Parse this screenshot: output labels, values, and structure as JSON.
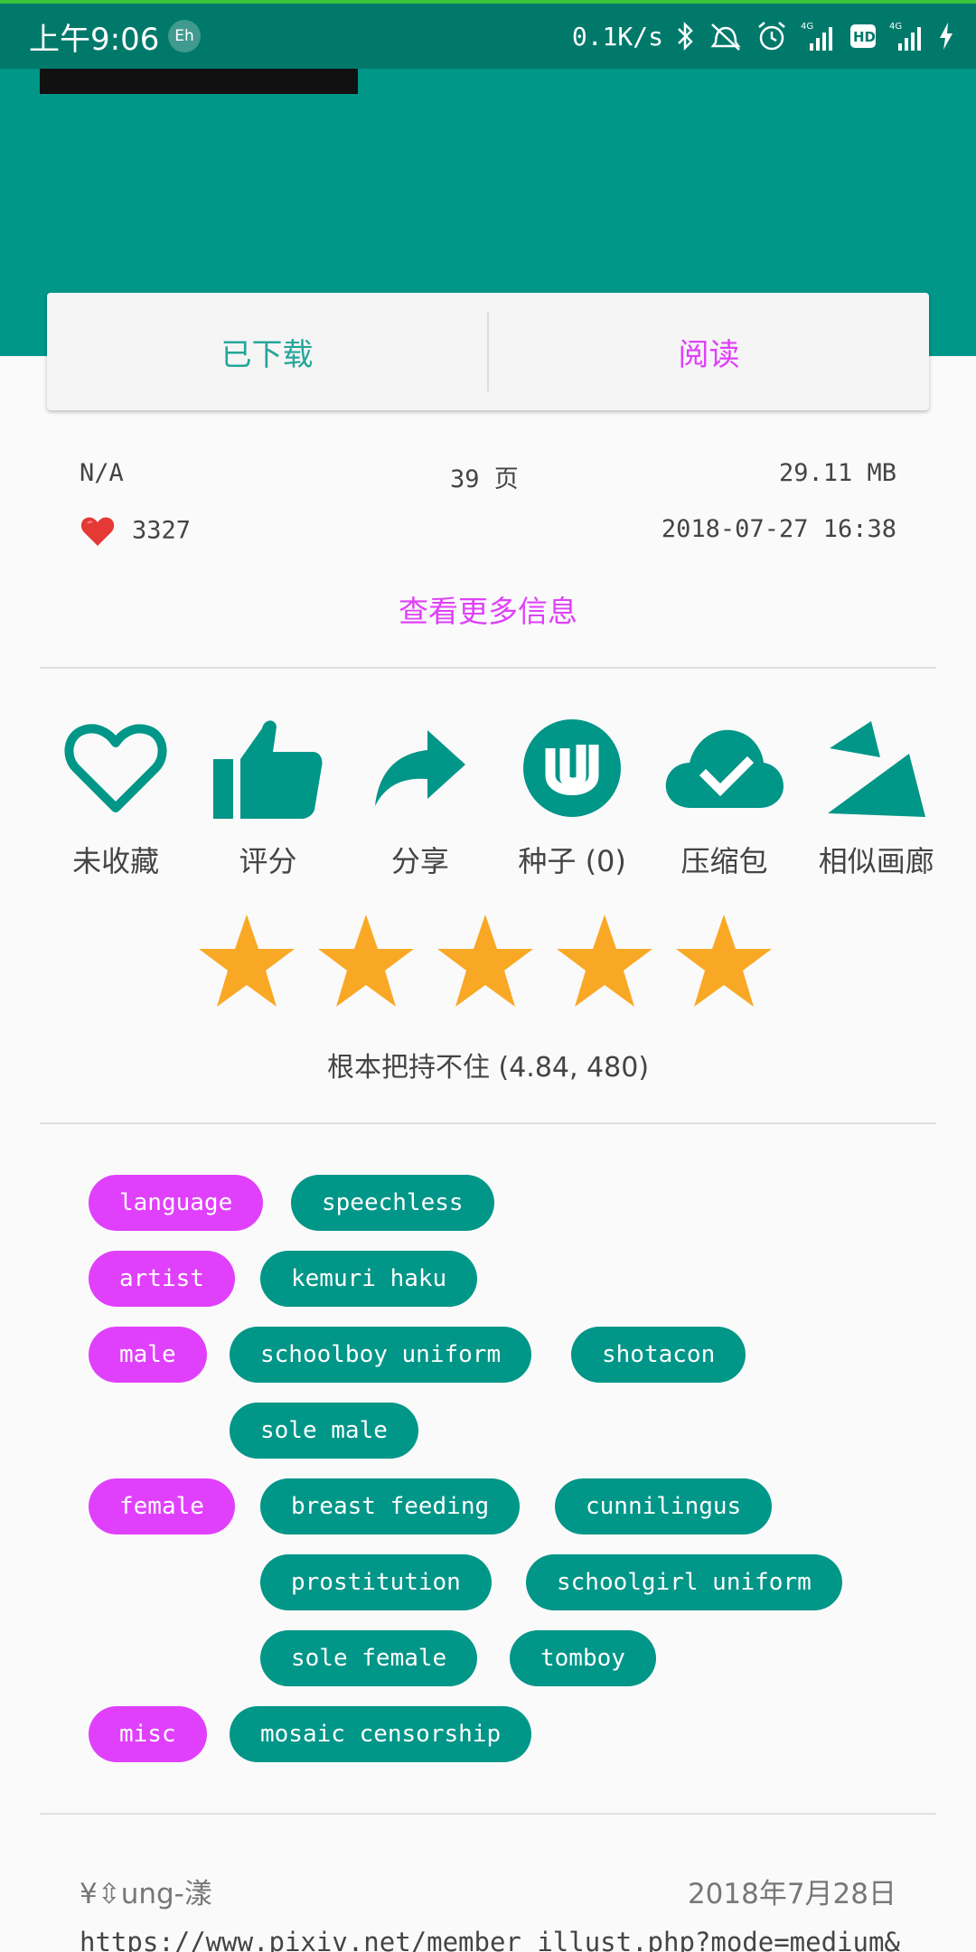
{
  "status_bar": {
    "time": "上午9:06",
    "eh_badge": "Eh",
    "net_speed": "0.1K/s",
    "network_4g": "4G",
    "hd": "HD"
  },
  "actions": {
    "downloaded_label": "已下载",
    "read_label": "阅读"
  },
  "info": {
    "language": "N/A",
    "pages": "39 页",
    "size": "29.11 MB",
    "favorites": "3327",
    "posted": "2018-07-27 16:38",
    "more_info": "查看更多信息"
  },
  "icon_actions": [
    {
      "label": "未收藏",
      "icon": "heart-outline-icon"
    },
    {
      "label": "评分",
      "icon": "thumb-up-icon"
    },
    {
      "label": "分享",
      "icon": "share-icon"
    },
    {
      "label": "种子 (0)",
      "icon": "torrent-icon"
    },
    {
      "label": "压缩包",
      "icon": "cloud-done-icon"
    },
    {
      "label": "相似画廊",
      "icon": "similar-icon"
    }
  ],
  "rating": {
    "stars": 5,
    "text": "根本把持不住 (4.84, 480)",
    "star_color": "#f9a825"
  },
  "tags": [
    {
      "namespace": "language",
      "values": [
        "speechless"
      ]
    },
    {
      "namespace": "artist",
      "values": [
        "kemuri haku"
      ]
    },
    {
      "namespace": "male",
      "values": [
        "schoolboy uniform",
        "shotacon",
        "sole male"
      ]
    },
    {
      "namespace": "female",
      "values": [
        "breast feeding",
        "cunnilingus",
        "prostitution",
        "schoolgirl uniform",
        "sole female",
        "tomboy"
      ]
    },
    {
      "namespace": "misc",
      "values": [
        "mosaic censorship"
      ]
    }
  ],
  "comment": {
    "user": "¥⇳ung-漾",
    "date": "2018年7月28日",
    "text": "https://www.pixiv.net/member_illust.php?mode=medium&"
  },
  "colors": {
    "primary": "#009688",
    "primary_dark": "#00796b",
    "accent": "#e040fb"
  }
}
